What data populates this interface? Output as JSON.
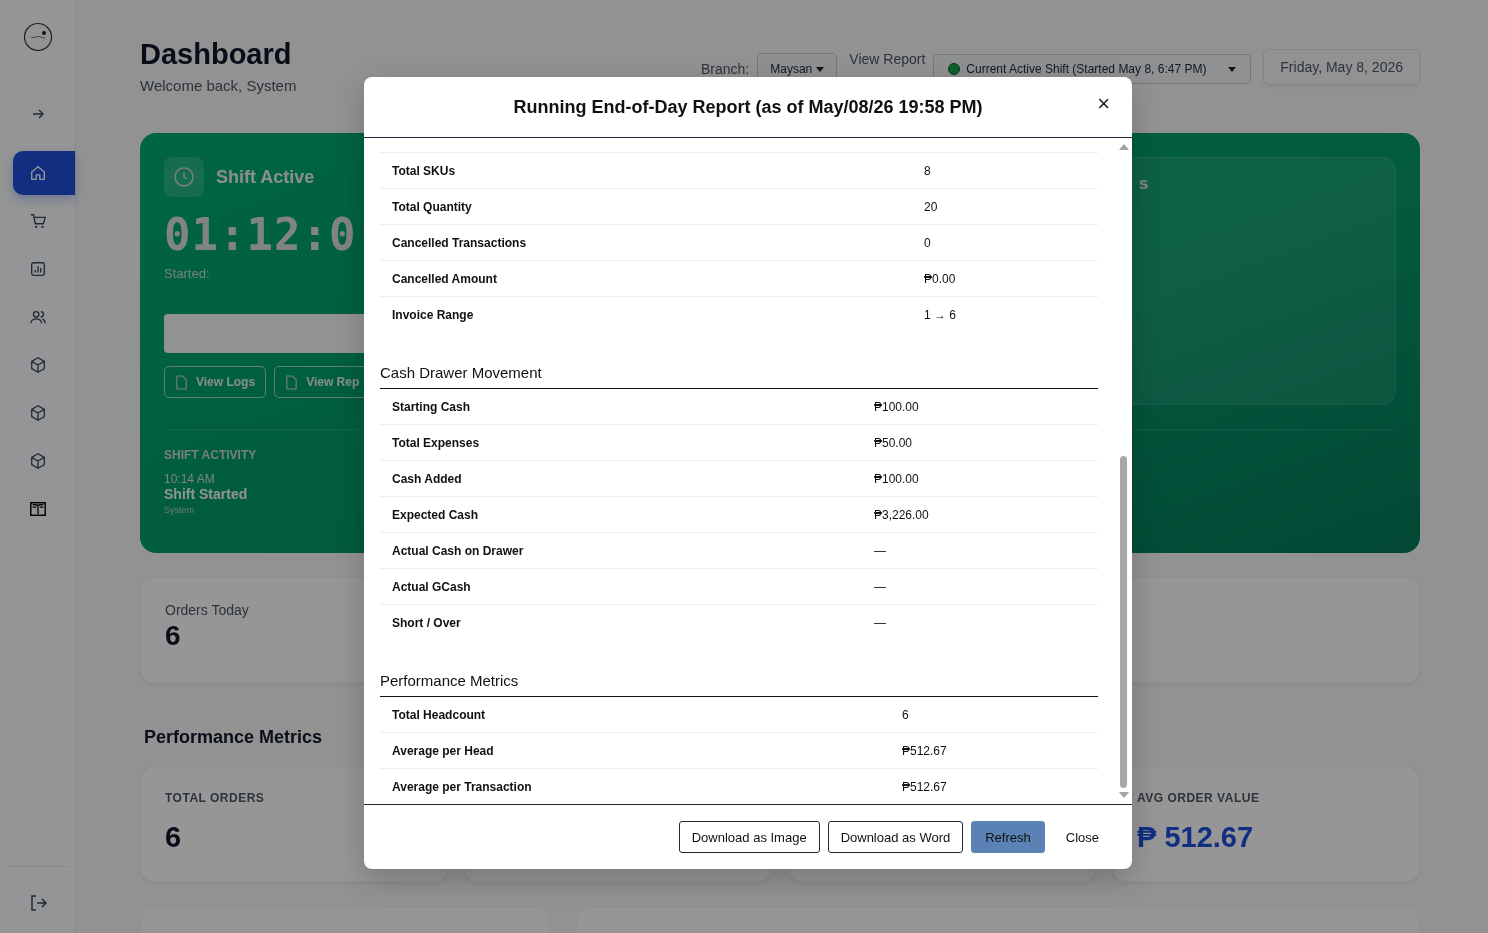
{
  "sidebar": {
    "items": [
      {
        "selected": true
      },
      {
        "selected": false
      },
      {
        "selected": false
      },
      {
        "selected": false
      },
      {
        "selected": false
      },
      {
        "selected": false
      },
      {
        "selected": false
      },
      {
        "selected": false
      }
    ]
  },
  "header": {
    "title": "Dashboard",
    "subtitle": "Welcome back, System",
    "branch_label": "Branch:",
    "branch": "Maysan",
    "view_report_label": "View Report",
    "shift_select": "Current Active Shift (Started May 8, 6:47 PM)",
    "date": "Friday, May 8, 2026"
  },
  "shift_card": {
    "title": "Shift Active",
    "timer": "01:12:0",
    "started_label": "Started:",
    "buttons": [
      "View Logs",
      "View Rep"
    ],
    "panel_heading": "s",
    "activity_title": "SHIFT ACTIVITY",
    "activity": [
      {
        "time": "10:14 AM",
        "event": "Shift Started",
        "by": "System"
      }
    ]
  },
  "summary_cards": [
    {
      "label": "Orders Today",
      "value": "6"
    }
  ],
  "performance": {
    "title": "Performance Metrics",
    "cards": [
      {
        "label": "TOTAL ORDERS",
        "value": "6"
      },
      {
        "label": "AVG ORDER VALUE",
        "value": "₱ 512.67"
      }
    ]
  },
  "modal": {
    "title": "Running End-of-Day Report (as of May/08/26 19:58 PM)",
    "close": "×",
    "sections": [
      {
        "rows": [
          {
            "label": "Total SKUs",
            "value": "8"
          },
          {
            "label": "Total Quantity",
            "value": "20"
          },
          {
            "label": "Cancelled Transactions",
            "value": "0"
          },
          {
            "label": "Cancelled Amount",
            "value": "₱0.00"
          },
          {
            "label": "Invoice Range",
            "value": "1 → 6"
          }
        ]
      },
      {
        "heading": "Cash Drawer Movement",
        "rows": [
          {
            "label": "Starting Cash",
            "value": "₱100.00"
          },
          {
            "label": "Total Expenses",
            "value": "₱50.00"
          },
          {
            "label": "Cash Added",
            "value": "₱100.00"
          },
          {
            "label": "Expected Cash",
            "value": "₱3,226.00"
          },
          {
            "label": "Actual Cash on Drawer",
            "value": "—"
          },
          {
            "label": "Actual GCash",
            "value": "—"
          },
          {
            "label": "Short / Over",
            "value": "—"
          }
        ]
      },
      {
        "heading": "Performance Metrics",
        "rows": [
          {
            "label": "Total Headcount",
            "value": "6"
          },
          {
            "label": "Average per Head",
            "value": "₱512.67"
          },
          {
            "label": "Average per Transaction",
            "value": "₱512.67"
          }
        ]
      }
    ],
    "buttons": [
      {
        "label": "Download as Image",
        "kind": "outline"
      },
      {
        "label": "Download as Word",
        "kind": "outline"
      },
      {
        "label": "Refresh",
        "kind": "primary"
      },
      {
        "label": "Close",
        "kind": "plain"
      }
    ]
  }
}
